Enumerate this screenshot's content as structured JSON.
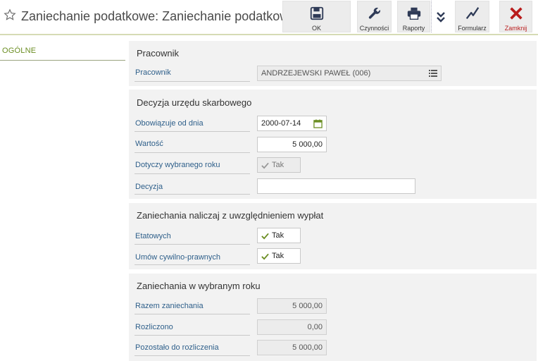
{
  "window": {
    "title": "Zaniechanie podatkowe: Zaniechanie podatkowe"
  },
  "toolbar": {
    "ok_label": "OK",
    "actions_label": "Czynności",
    "reports_label": "Raporty",
    "form_label": "Formularz",
    "close_label": "Zamknij"
  },
  "sidebar": {
    "tabs": [
      {
        "label": "OGÓLNE"
      }
    ]
  },
  "sections": {
    "employee": {
      "title": "Pracownik",
      "employee_label": "Pracownik",
      "employee_value": "ANDRZEJEWSKI PAWEŁ (006)"
    },
    "decision": {
      "title": "Decyzja urzędu skarbowego",
      "valid_from_label": "Obowiązuje od dnia",
      "valid_from_value": "2000-07-14",
      "value_label": "Wartość",
      "value_value": "5 000,00",
      "year_label": "Dotyczy wybranego roku",
      "year_value": "Tak",
      "decision_label": "Decyzja",
      "decision_value": ""
    },
    "calc": {
      "title": "Zaniechania naliczaj z uwzględnieniem wypłat",
      "full_time_label": "Etatowych",
      "full_time_value": "Tak",
      "civil_label": "Umów cywilno-prawnych",
      "civil_value": "Tak"
    },
    "year": {
      "title": "Zaniechania w wybranym roku",
      "total_label": "Razem zaniechania",
      "total_value": "5 000,00",
      "settled_label": "Rozliczono",
      "settled_value": "0,00",
      "remaining_label": "Pozostało do rozliczenia",
      "remaining_value": "5 000,00"
    }
  },
  "colors": {
    "accent_green": "#6b8e23",
    "label_blue": "#2e5f8a",
    "close_red": "#b91c1c"
  }
}
